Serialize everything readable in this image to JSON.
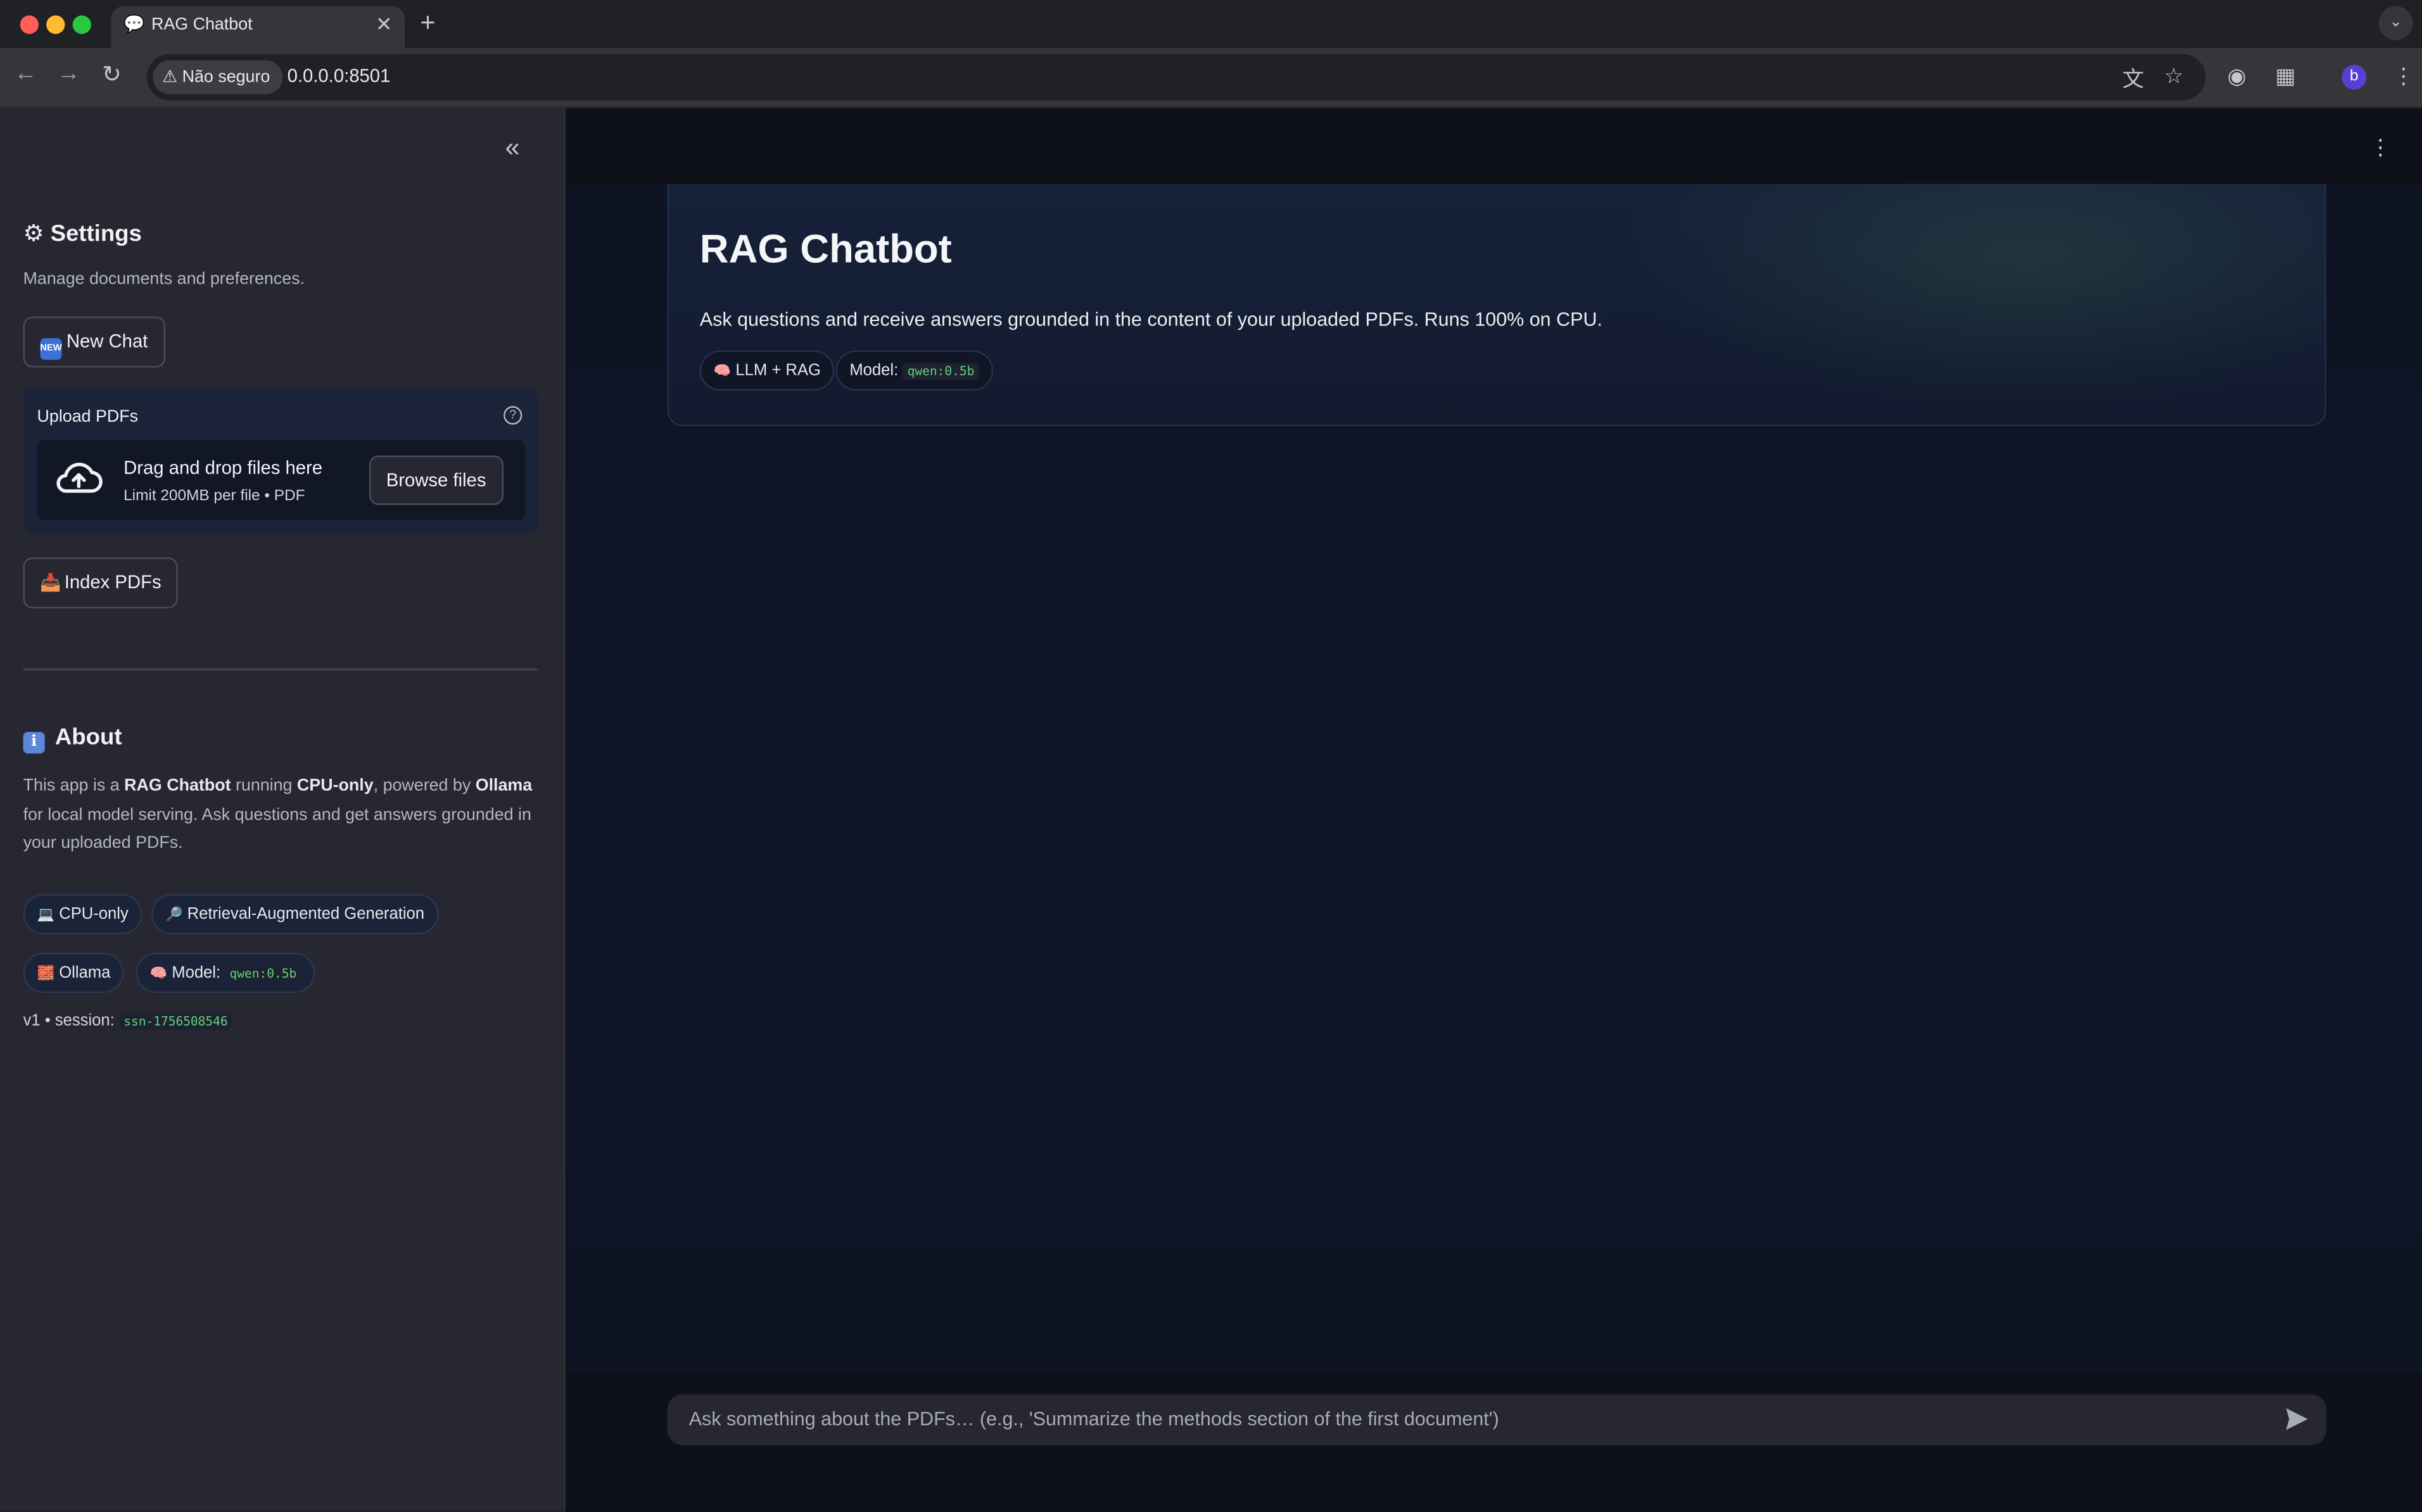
{
  "browser": {
    "tab_title": "RAG Chatbot",
    "tab_favicon": "chat-bubble-icon",
    "security_label": "Não seguro",
    "url": "0.0.0.0:8501",
    "profile_initial": "b"
  },
  "sidebar": {
    "settings_title": "Settings",
    "settings_subtitle": "Manage documents and preferences.",
    "new_chat_label": "New Chat",
    "new_chat_badge": "NEW",
    "upload_label": "Upload PDFs",
    "dropzone_title": "Drag and drop files here",
    "dropzone_limit": "Limit 200MB per file • PDF",
    "browse_label": "Browse files",
    "index_label": "Index PDFs",
    "about_title": "About",
    "about_icon": "i",
    "about_text": {
      "p1": "This app is a ",
      "b1": "RAG Chatbot",
      "p2": " running ",
      "b2": "CPU-only",
      "p3": ", powered by ",
      "b3": "Ollama",
      "p4": " for local model serving. Ask questions and get answers grounded in your uploaded PDFs."
    },
    "pills": {
      "cpu": "CPU-only",
      "rag": "Retrieval-Augmented Generation",
      "ollama": "Ollama",
      "model_label": "Model:",
      "model_value": "qwen:0.5b"
    },
    "session_label": "v1 • session:",
    "session_id": "ssn-1756508546"
  },
  "main": {
    "title": "RAG Chatbot",
    "subtitle": "Ask questions and receive answers grounded in the content of your uploaded PDFs. Runs 100% on CPU.",
    "pill_llm": "LLM + RAG",
    "model_label": "Model:",
    "model_value": "qwen:0.5b",
    "chat_placeholder": "Ask something about the PDFs… (e.g., 'Summarize the methods section of the first document')"
  },
  "colors": {
    "sidebar_bg": "#262730",
    "main_bg": "#0e1117",
    "hero_bg": "#16223a",
    "code_green": "#5fd37a"
  }
}
